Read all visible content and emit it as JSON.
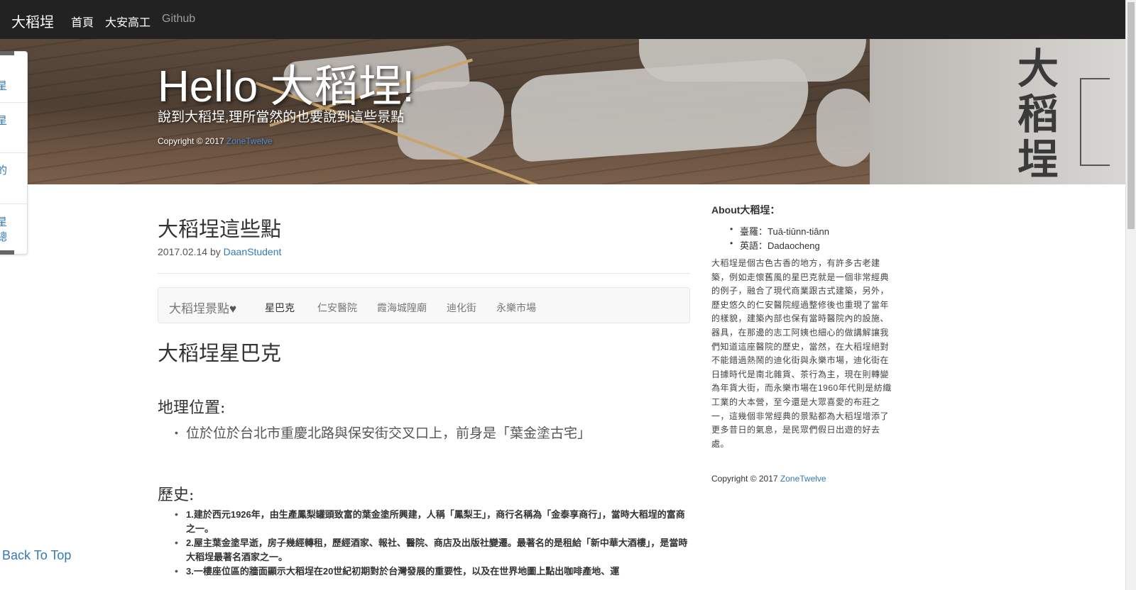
{
  "navbar": {
    "brand": "大稻埕",
    "links": [
      "首頁",
      "大安高工",
      "Github"
    ]
  },
  "hero": {
    "title": "Hello 大稻埕!",
    "subtitle": "說到大稻埕,理所當然的也要說到這些景點",
    "copyright_prefix": "Copyright © 2017 ",
    "copyright_link": "ZoneTwelve",
    "sign_text": "大稻埕"
  },
  "side_menu": {
    "items": [
      "星",
      "星",
      "的",
      "星",
      "總"
    ]
  },
  "post": {
    "title": "大稻埕這些點",
    "date": "2017.02.14",
    "by": " by ",
    "author": "DaanStudent"
  },
  "tabs": {
    "brand": "大稻埕景點",
    "heart": "♥",
    "items": [
      "星巴克",
      "仁安醫院",
      "霞海城隍廟",
      "迪化街",
      "永樂市場"
    ],
    "active_index": 0
  },
  "section": {
    "title": "大稻埕星巴克",
    "geo_heading": "地理位置:",
    "geo_items": [
      "位於位於台北市重慶北路與保安街交叉口上，前身是「葉金塗古宅」"
    ],
    "history_heading": "歷史:",
    "history_items": [
      "1.建於西元1926年，由生產鳳梨罐頭致富的葉金塗所興建，人稱「鳳梨王」，商行名稱為「金泰享商行」，當時大稻埕的富商之一。",
      "2.屋主葉金塗早逝，房子幾經轉租，歷經酒家、報社、醫院、商店及出版社變遷。最著名的是租給「新中華大酒樓」，是當時大稻埕最著名酒家之一。",
      "3.一樓座位區的牆面顯示大稻埕在20世紀初期對於台灣發展的重要性，以及在世界地圖上點出咖啡產地、運"
    ]
  },
  "sidebar": {
    "about_title": "About大稻埕：",
    "names": [
      "臺羅：Tuā-tiūnn-tiânn",
      "英語：Dadaocheng"
    ],
    "description": "大稻埕是個古色古香的地方，有許多古老建築，例如走懷舊風的星巴克就是一個非常經典的例子，融合了現代商業跟古式建築，另外，歷史悠久的仁安醫院經過整修後也重現了當年的樣貌，建築內部也保有當時醫院內的設施、器具，在那邊的志工阿姨也細心的做講解讓我們知道這座醫院的歷史，當然，在大稻埕絕對不能錯過熱鬧的迪化街與永樂市場，迪化街在日據時代是南北雜貨、茶行為主，現在則轉變為年貨大街，而永樂市場在1960年代則是紡織工業的大本營，至今還是大眾喜愛的布莊之一，這幾個非常經典的景點都為大稻埕增添了更多昔日的氣息，是民眾們假日出遊的好去處。",
    "copyright_prefix": "Copyright © 2017 ",
    "copyright_link": "ZoneTwelve"
  },
  "back_to_top": "Back To Top",
  "colors": {
    "navbar_bg": "#222222",
    "link": "#337ab7",
    "nav_muted": "#9d9d9d"
  }
}
